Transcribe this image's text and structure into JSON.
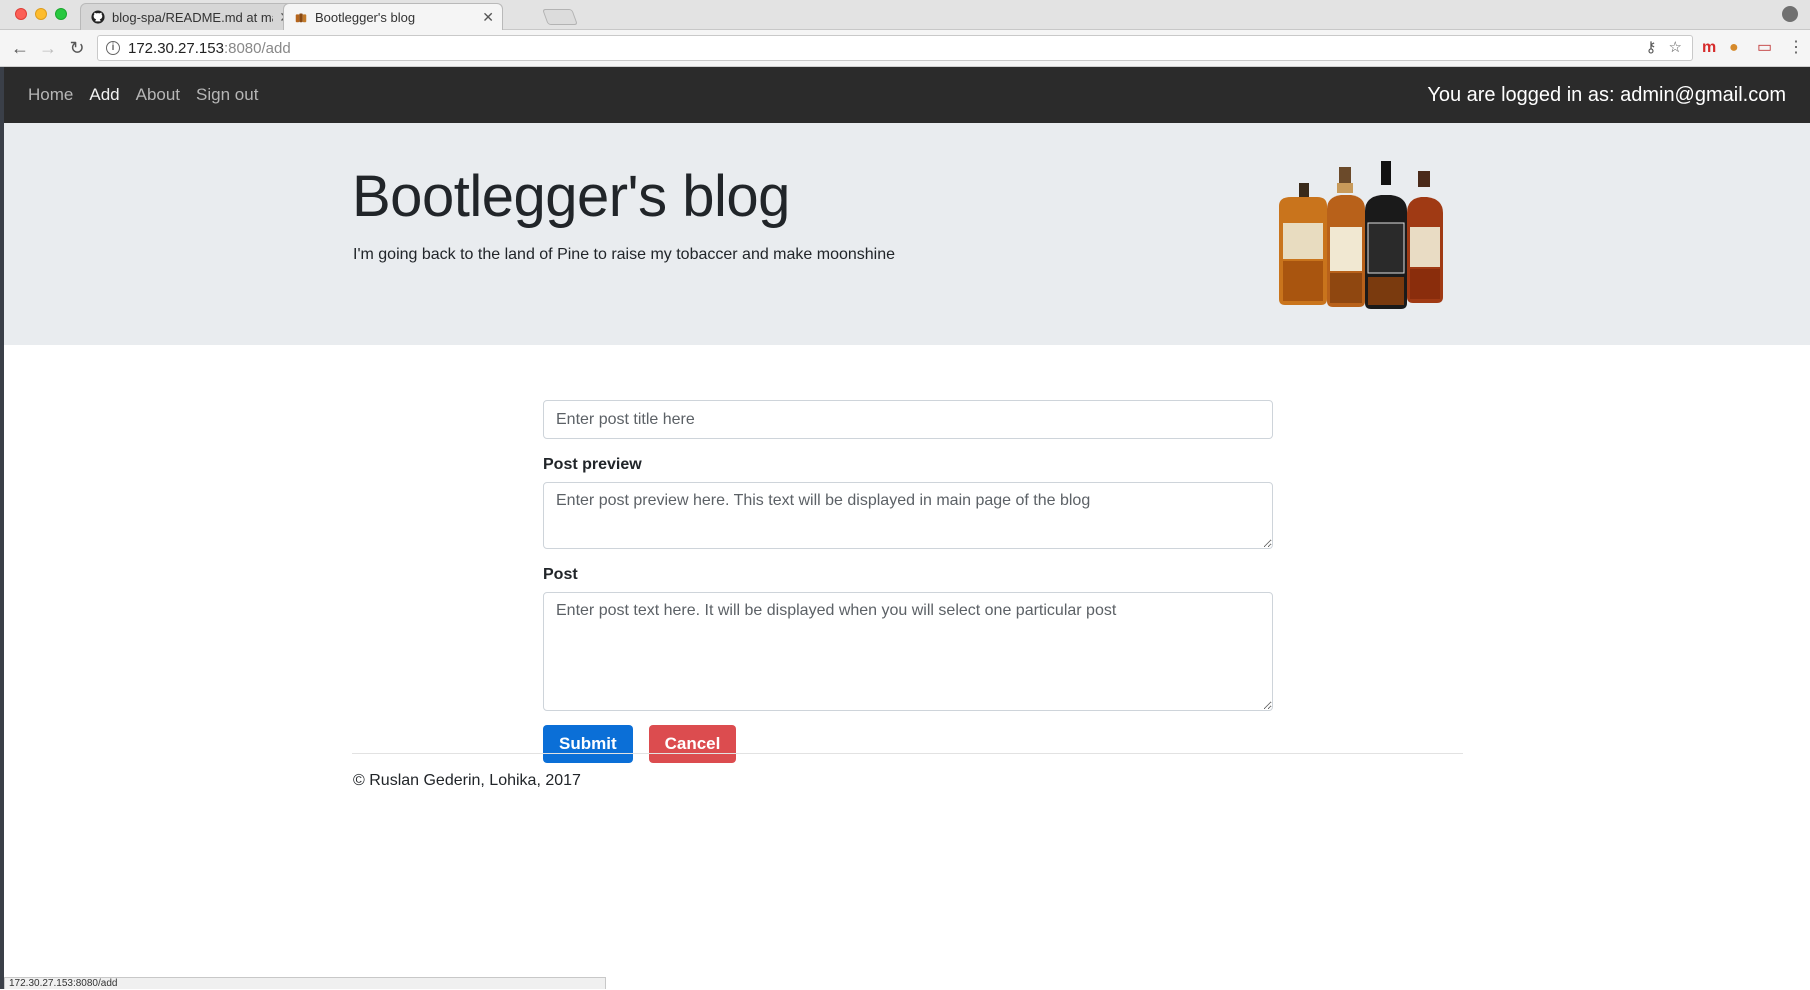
{
  "browser": {
    "tabs": [
      {
        "title": "blog-spa/README.md at mast",
        "favicon": "github-icon",
        "active": false
      },
      {
        "title": "Bootlegger's blog",
        "favicon": "bottle-favicon",
        "active": true
      }
    ],
    "url_host": "172.30.27.153",
    "url_path": ":8080/add",
    "status_bar": "172.30.27.153:8080/add"
  },
  "nav": {
    "links": [
      {
        "label": "Home",
        "active": false
      },
      {
        "label": "Add",
        "active": true
      },
      {
        "label": "About",
        "active": false
      },
      {
        "label": "Sign out",
        "active": false
      }
    ],
    "logged_in": "You are logged in as: admin@gmail.com"
  },
  "header": {
    "title": "Bootlegger's blog",
    "subtitle": "I'm going back to the land of Pine to raise my tobaccer and make moonshine"
  },
  "form": {
    "title_placeholder": "Enter post title here",
    "preview_label": "Post preview",
    "preview_placeholder": "Enter post preview here. This text will be displayed in main page of the blog",
    "post_label": "Post",
    "post_placeholder": "Enter post text here. It will be displayed when you will select one particular post",
    "submit": "Submit",
    "cancel": "Cancel"
  },
  "footer": {
    "copyright": "© Ruslan Gederin, Lohika, 2017"
  },
  "colors": {
    "navbar": "#2b2b2b",
    "jumbotron": "#e9ecef",
    "primary": "#0b6fd7",
    "danger": "#dc4c4f"
  }
}
